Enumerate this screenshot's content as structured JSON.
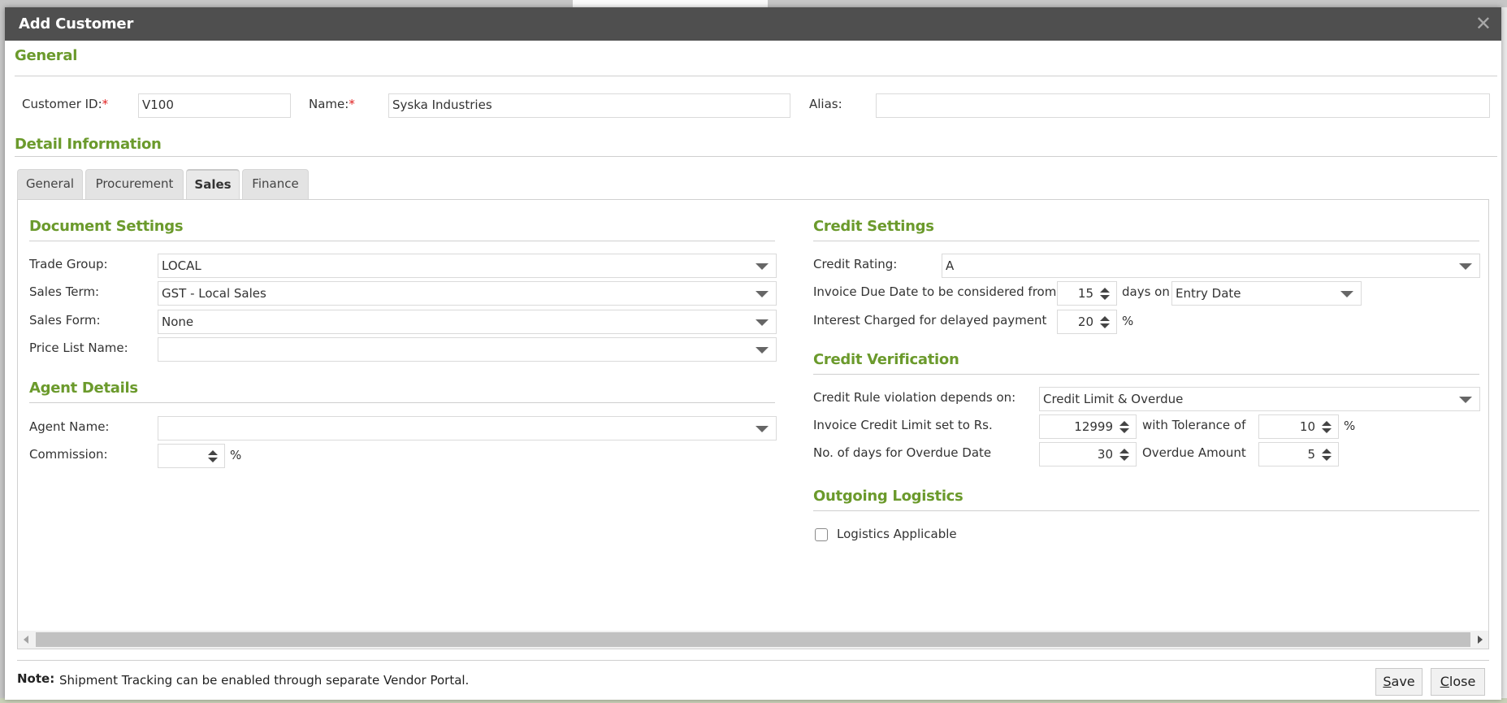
{
  "dialog": {
    "title": "Add Customer",
    "close_icon": "close-x-icon"
  },
  "general": {
    "heading": "General",
    "customer_id_label": "Customer ID:",
    "customer_id_value": "V100",
    "name_label": "Name:",
    "name_value": "Syska Industries",
    "alias_label": "Alias:",
    "alias_value": "",
    "required_marker": "*"
  },
  "detail": {
    "heading": "Detail Information",
    "tabs": [
      {
        "label": "General",
        "active": false
      },
      {
        "label": "Procurement",
        "active": false
      },
      {
        "label": "Sales",
        "active": true
      },
      {
        "label": "Finance",
        "active": false
      }
    ]
  },
  "document_settings": {
    "heading": "Document Settings",
    "trade_group_label": "Trade Group:",
    "trade_group_value": "LOCAL",
    "sales_term_label": "Sales Term:",
    "sales_term_value": "GST - Local Sales",
    "sales_form_label": "Sales Form:",
    "sales_form_value": "None",
    "price_list_label": "Price List Name:",
    "price_list_value": ""
  },
  "agent_details": {
    "heading": "Agent Details",
    "agent_name_label": "Agent Name:",
    "agent_name_value": "",
    "commission_label": "Commission:",
    "commission_value": "",
    "commission_unit": "%"
  },
  "credit_settings": {
    "heading": "Credit Settings",
    "credit_rating_label": "Credit Rating:",
    "credit_rating_value": "A",
    "due_date_label": "Invoice Due Date to be considered from",
    "due_date_days": "15",
    "days_on_label": "days on",
    "days_on_value": "Entry Date",
    "interest_label": "Interest Charged for delayed payment",
    "interest_value": "20",
    "interest_unit": "%"
  },
  "credit_verification": {
    "heading": "Credit Verification",
    "rule_label": "Credit Rule violation depends on:",
    "rule_value": "Credit Limit & Overdue",
    "limit_label": "Invoice Credit Limit set to Rs.",
    "limit_value": "12999",
    "tolerance_label": "with Tolerance of",
    "tolerance_value": "10",
    "tolerance_unit": "%",
    "overdue_days_label": "No. of days for Overdue Date",
    "overdue_days_value": "30",
    "overdue_amount_label": "Overdue Amount",
    "overdue_amount_value": "5"
  },
  "outgoing_logistics": {
    "heading": "Outgoing Logistics",
    "logistics_label": "Logistics Applicable",
    "logistics_checked": false
  },
  "footer": {
    "note_label": "Note:",
    "note_text": "Shipment Tracking can be enabled through separate Vendor Portal.",
    "save_accel": "S",
    "save_rest": "ave",
    "close_accel": "C",
    "close_rest": "lose"
  },
  "colors": {
    "header_bg": "#4f4f4f",
    "section_heading": "#6b9a2c",
    "required": "#e02020"
  }
}
